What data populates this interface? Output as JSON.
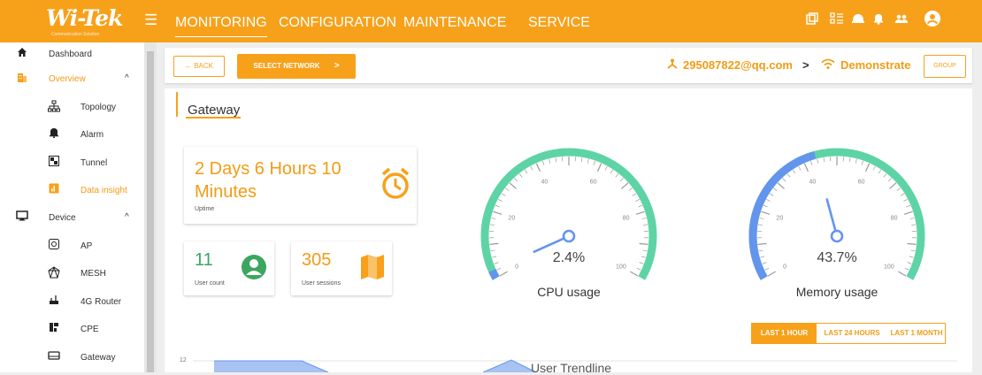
{
  "header": {
    "logo_text": "Wi-Tek",
    "logo_subtext": "Communication Solution",
    "nav": [
      "MONITORING",
      "CONFIGURATION",
      "MAINTENANCE",
      "SERVICE"
    ],
    "active_nav": "MONITORING"
  },
  "sidebar": {
    "dashboard": "Dashboard",
    "overview": "Overview",
    "overview_items": [
      "Topology",
      "Alarm",
      "Tunnel",
      "Data insight"
    ],
    "device": "Device",
    "device_items": [
      "AP",
      "MESH",
      "4G Router",
      "CPE",
      "Gateway"
    ]
  },
  "toolbar": {
    "back_label": "← BACK",
    "select_network_label": "SELECT NETWORK",
    "account": "295087822@qq.com",
    "separator": ">",
    "network": "Demonstrate",
    "group_label": "GROUP"
  },
  "gateway": {
    "title": "Gateway",
    "uptime_value": "2 Days 6 Hours 10 Minutes",
    "uptime_label": "Uptime",
    "user_count_value": "11",
    "user_count_label": "User count",
    "user_sessions_value": "305",
    "user_sessions_label": "User sessions"
  },
  "cpu_gauge": {
    "value": "2.4%",
    "title": "CPU usage",
    "percent": 2.4,
    "ticks": [
      "0",
      "20",
      "40",
      "60",
      "80",
      "100"
    ]
  },
  "memory_gauge": {
    "value": "43.7%",
    "title": "Memory usage",
    "percent": 43.7,
    "ticks": [
      "0",
      "20",
      "40",
      "60",
      "80",
      "100"
    ]
  },
  "time_range": {
    "options": [
      "LAST 1 HOUR",
      "LAST 24 HOURS",
      "LAST 1 MONTH"
    ],
    "selected": "LAST 1 HOUR"
  },
  "trendline": {
    "title": "User Trendline",
    "y_tick": "12"
  },
  "colors": {
    "brand": "#f7a11a",
    "accent_text": "#f29c14",
    "gauge_green": "#5ed4a6",
    "gauge_blue": "#6495ed",
    "user_count_green": "#3aa65f"
  },
  "icons": {
    "topbar": [
      "copy-icon",
      "list-icon",
      "helmet-icon",
      "bell-icon",
      "users-icon",
      "user-circle-icon"
    ]
  }
}
